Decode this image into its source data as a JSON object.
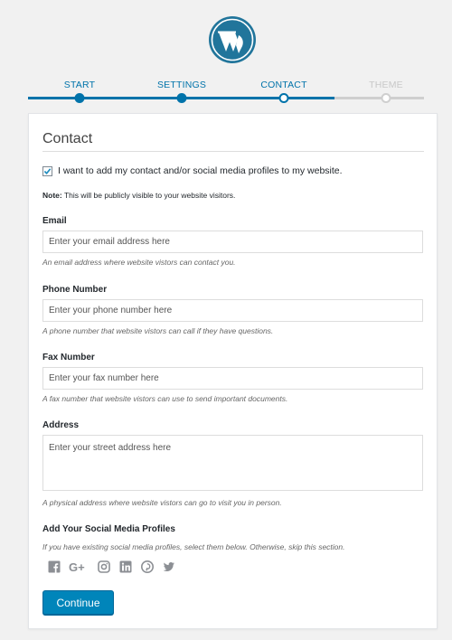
{
  "colors": {
    "accent": "#0073aa",
    "button": "#0085ba",
    "inactive": "#cfcfcf"
  },
  "logo": {
    "icon": "wordpress-logo"
  },
  "stepper": {
    "steps": [
      {
        "label": "START",
        "state": "done"
      },
      {
        "label": "SETTINGS",
        "state": "done"
      },
      {
        "label": "CONTACT",
        "state": "current"
      },
      {
        "label": "THEME",
        "state": "todo"
      }
    ]
  },
  "card": {
    "title": "Contact",
    "checkbox": {
      "checked": true,
      "label": "I want to add my contact and/or social media profiles to my website."
    },
    "note": {
      "prefix": "Note:",
      "text": "This will be publicly visible to your website visitors."
    },
    "email": {
      "label": "Email",
      "placeholder": "Enter your email address here",
      "help": "An email address where website vistors can contact you."
    },
    "phone": {
      "label": "Phone Number",
      "placeholder": "Enter your phone number here",
      "help": "A phone number that website vistors can call if they have questions."
    },
    "fax": {
      "label": "Fax Number",
      "placeholder": "Enter your fax number here",
      "help": "A fax number that website vistors can use to send important documents."
    },
    "address": {
      "label": "Address",
      "placeholder": "Enter your street address here",
      "help": "A physical address where website vistors can go to visit you in person."
    },
    "social": {
      "heading": "Add Your Social Media Profiles",
      "help": "If you have existing social media profiles, select them below. Otherwise, skip this section.",
      "icons": [
        "facebook-icon",
        "google-plus-icon",
        "instagram-icon",
        "linkedin-icon",
        "pinterest-icon",
        "twitter-icon"
      ]
    },
    "continue_label": "Continue"
  }
}
